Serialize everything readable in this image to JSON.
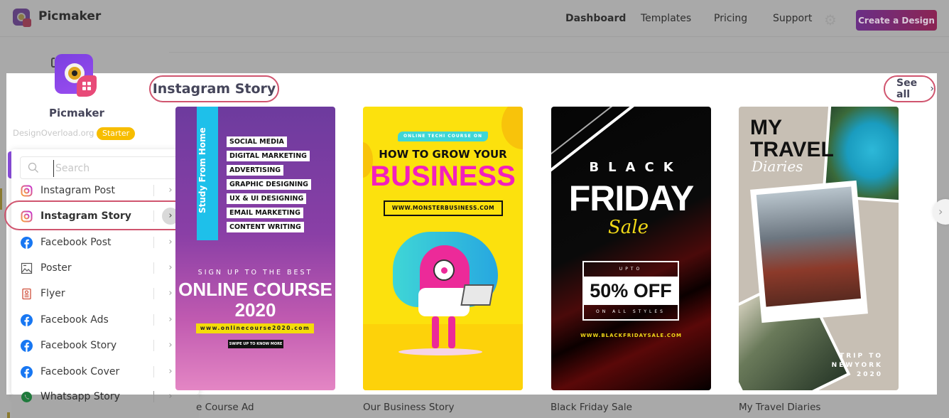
{
  "header": {
    "brand": "Picmaker",
    "nav": [
      {
        "label": "Dashboard",
        "active": true
      },
      {
        "label": "Templates",
        "active": false
      },
      {
        "label": "Pricing",
        "active": false
      },
      {
        "label": "Support",
        "active": false
      }
    ],
    "settings_icon": "gear-icon",
    "cta_label": "Create a Design"
  },
  "profile": {
    "name": "Picmaker",
    "site": "DesignOverload.org",
    "plan": "Starter"
  },
  "menu": {
    "search_placeholder": "Search",
    "search_value": "",
    "items": [
      {
        "label": "Instagram Post",
        "icon": "instagram-icon",
        "selected": false
      },
      {
        "label": "Instagram Story",
        "icon": "instagram-icon",
        "selected": true
      },
      {
        "label": "Facebook Post",
        "icon": "facebook-icon",
        "selected": false
      },
      {
        "label": "Poster",
        "icon": "image-icon",
        "selected": false
      },
      {
        "label": "Flyer",
        "icon": "flyer-icon",
        "selected": false
      },
      {
        "label": "Facebook Ads",
        "icon": "facebook-icon",
        "selected": false
      },
      {
        "label": "Facebook Story",
        "icon": "facebook-icon",
        "selected": false
      },
      {
        "label": "Facebook Cover",
        "icon": "facebook-icon",
        "selected": false
      },
      {
        "label": "Whatsapp Story",
        "icon": "whatsapp-icon",
        "selected": false
      }
    ]
  },
  "section": {
    "title": "Instagram Story",
    "see_all": "See all",
    "see_all_arrow": "›",
    "next_arrow": "›"
  },
  "templates": [
    {
      "title": "e Course Ad",
      "vertical_text": "Study From Home",
      "topics": [
        "SOCIAL MEDIA",
        "DIGITAL MARKETING",
        "ADVERTISING",
        "GRAPHIC DESIGNING",
        "UX & UI DESIGNING",
        "EMAIL MARKETING",
        "CONTENT WRITING"
      ],
      "tagline": "SIGN UP TO THE BEST",
      "headline": "ONLINE COURSE",
      "year": "2020",
      "url": "www.onlinecourse2020.com",
      "cta": "SWIPE UP TO KNOW MORE"
    },
    {
      "title": "Our Business Story",
      "pill": "ONLINE TECHI COURSE ON",
      "headline": "HOW TO GROW YOUR",
      "big": "BUSINESS",
      "url": "WWW.MONSTERBUSINESS.COM"
    },
    {
      "title": "Black Friday Sale",
      "line1": "BLACK",
      "line2": "FRIDAY",
      "script": "Sale",
      "upto": "UPTO",
      "offer": "50% OFF",
      "styles": "ON ALL STYLES",
      "url": "WWW.BLACKFRIDAYSALE.COM"
    },
    {
      "title": "My Travel Diaries",
      "heading1": "MY",
      "heading2": "TRAVEL",
      "script": "Diaries",
      "trip1": "TRIP TO",
      "trip2": "NEWYORK",
      "trip3": "2020"
    }
  ],
  "colors": {
    "accent_gradient_start": "#8e44ad",
    "accent_gradient_end": "#d63a6e",
    "highlight_ring": "#d0556f",
    "badge": "#f7bd00",
    "dim_overlay": "#a9a9a9"
  }
}
